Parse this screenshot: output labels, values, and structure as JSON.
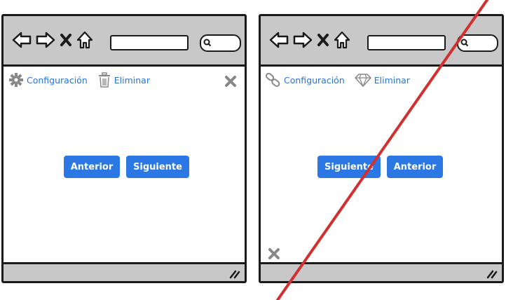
{
  "left_panel": {
    "toolbar": {
      "link1": {
        "label": "Configuración",
        "icon": "gear-icon"
      },
      "link2": {
        "label": "Eliminar",
        "icon": "trash-icon"
      }
    },
    "buttons": {
      "first": "Anterior",
      "second": "Siguiente"
    }
  },
  "right_panel": {
    "toolbar": {
      "link1": {
        "label": "Configuración",
        "icon": "link-icon"
      },
      "link2": {
        "label": "Eliminar",
        "icon": "diamond-icon"
      }
    },
    "buttons": {
      "first": "Siguiente",
      "second": "Anterior"
    },
    "crossed_out": true
  },
  "colors": {
    "accent": "#2b78e4",
    "link": "#2b73d6",
    "chrome": "#c8c8c8",
    "strike": "#d32f2f"
  }
}
